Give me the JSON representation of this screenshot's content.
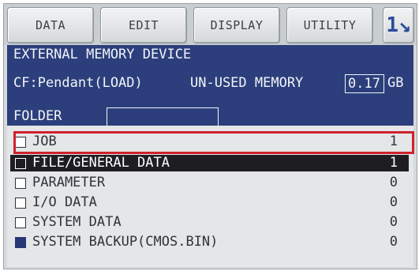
{
  "menu": {
    "tabs": [
      "DATA",
      "EDIT",
      "DISPLAY",
      "UTILITY"
    ],
    "page_button": "1↘"
  },
  "header": {
    "title": "EXTERNAL MEMORY DEVICE",
    "device": "CF:Pendant(LOAD)",
    "memory_label": "UN-USED MEMORY",
    "memory_value": "0.17",
    "memory_unit": "GB",
    "folder_label": "FOLDER",
    "folder_value": ""
  },
  "list": {
    "items": [
      {
        "label": "JOB",
        "count": "1",
        "checked": false,
        "selected": false
      },
      {
        "label": "FILE/GENERAL DATA",
        "count": "1",
        "checked": false,
        "selected": true
      },
      {
        "label": "PARAMETER",
        "count": "0",
        "checked": false,
        "selected": false
      },
      {
        "label": "I/O DATA",
        "count": "0",
        "checked": false,
        "selected": false
      },
      {
        "label": "SYSTEM DATA",
        "count": "0",
        "checked": false,
        "selected": false
      },
      {
        "label": "SYSTEM BACKUP(CMOS.BIN)",
        "count": "0",
        "checked": true,
        "selected": false
      }
    ]
  },
  "colors": {
    "header_bg": "#2c3f7c",
    "selected_row_bg": "#1e1e22",
    "highlight_border": "#d0212c"
  }
}
